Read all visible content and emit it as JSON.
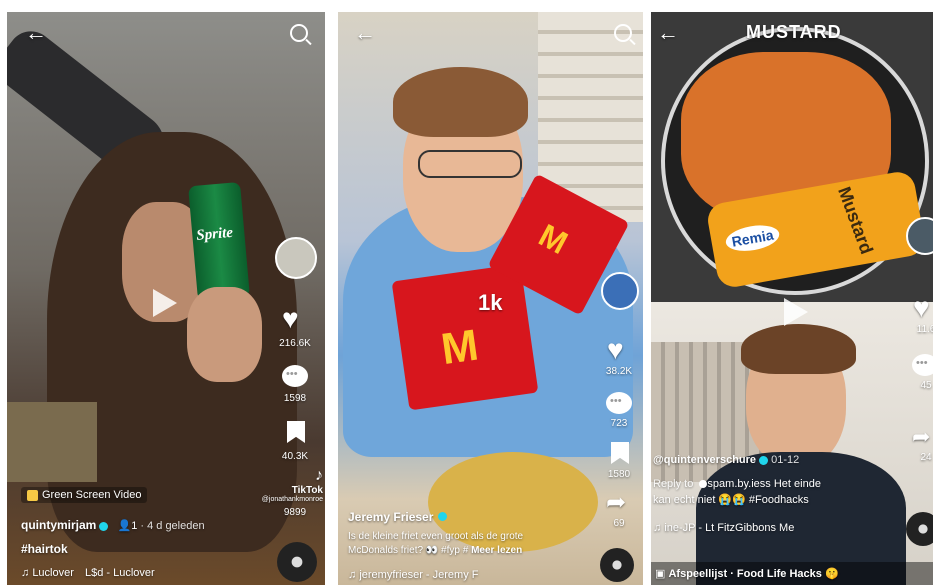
{
  "panel1": {
    "can_text": "Sprite",
    "like_count": "216.6K",
    "comment_count": "1598",
    "share_count": "40.3K",
    "effect_label": "Green Screen Video",
    "username": "quintymirjam",
    "friends_count": "1",
    "age": "· 4 d geleden",
    "hashtag": "#hairtok",
    "sound_artist": "Luclover",
    "sound_title": "L$d - Luclover",
    "watermark_brand": "TikTok",
    "watermark_handle": "@jonathankmonroe",
    "watermark_count": "9899"
  },
  "panel2": {
    "overlay_text": "1k",
    "like_count": "38.2K",
    "comment_count": "723",
    "save_count": "1580",
    "share_count": "69",
    "username": "Jeremy Frieser",
    "caption_line1": "Is de kleine friet even groot als de grote",
    "caption_line2": "McDonalds friet? 👀 #fyp #",
    "read_more": "Meer lezen",
    "sound": "jeremyfrieser - Jeremy F"
  },
  "panel3": {
    "top_title": "MUSTARD",
    "bottle_brand": "Remia",
    "bottle_word": "Mustard",
    "like_count": "11.6",
    "comment_count": "45",
    "share_count": "24",
    "username": "@quintenverschure",
    "date": "01-12",
    "reply_line_prefix": "Reply to",
    "reply_user": "spam.by.iess",
    "reply_text": "Het einde",
    "reply_line2": "kan echt niet 😭😭 #Foodhacks",
    "sound": "ine-JP - Lt FitzGibbons Me",
    "playlist": "Afspeellijst · Food Life Hacks 🤫"
  }
}
